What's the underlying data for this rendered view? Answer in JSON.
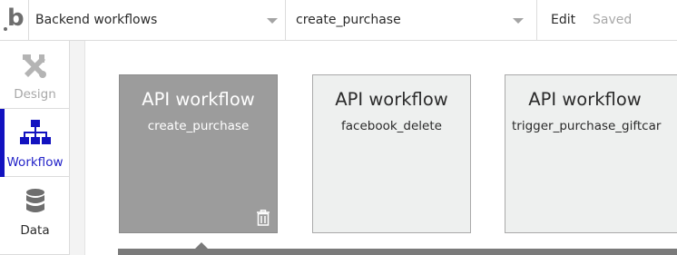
{
  "topbar": {
    "page_dropdown": "Backend workflows",
    "workflow_dropdown": "create_purchase",
    "edit_label": "Edit",
    "status_label": "Saved"
  },
  "sidebar": {
    "items": [
      {
        "label": "Design",
        "icon": "design-icon",
        "active": false
      },
      {
        "label": "Workflow",
        "icon": "workflow-icon",
        "active": true
      },
      {
        "label": "Data",
        "icon": "database-icon",
        "active": false
      }
    ]
  },
  "workflows": [
    {
      "title": "API workflow",
      "name": "create_purchase",
      "selected": true
    },
    {
      "title": "API workflow",
      "name": "facebook_delete",
      "selected": false
    },
    {
      "title": "API workflow",
      "name": "trigger_purchase_giftcar",
      "selected": false
    }
  ],
  "colors": {
    "accent": "#1212c0",
    "selected_card": "#9c9c9c",
    "card": "#eef0ef"
  }
}
